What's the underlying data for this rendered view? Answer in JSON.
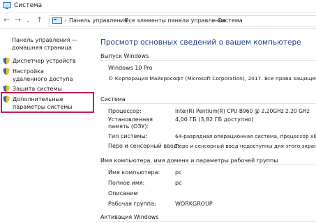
{
  "window": {
    "title": "Система"
  },
  "breadcrumb": [
    "Панель управления",
    "Все элементы панели управления",
    "Система"
  ],
  "sidebar": {
    "home": "Панель управления — домашняя страница",
    "items": [
      {
        "label": "Диспетчер устройств"
      },
      {
        "label": "Настройка удаленного доступа"
      },
      {
        "label": "Защита системы"
      },
      {
        "label": "Дополнительные параметры системы"
      }
    ]
  },
  "main": {
    "title": "Просмотр основных сведений о вашем компьютере",
    "edition": {
      "heading": "Выпуск Windows",
      "name": "Windows 10 Pro",
      "copyright": "© Корпорация Майкрософт (Microsoft Corporation), 2017. Все права защищены."
    },
    "system": {
      "heading": "Система",
      "rows": [
        {
          "key": "Процессор:",
          "value": "Intel(R) Pentium(R) CPU B960 @ 2.20GHz   2.20 GHz"
        },
        {
          "key": "Установленная память (ОЗУ):",
          "value": "4,00 ГБ (3,82 ГБ доступно)"
        },
        {
          "key": "Тип системы:",
          "value": "64-разрядная операционная система, процессор x64"
        },
        {
          "key": "Перо и сенсорный ввод:",
          "value": "Перо и сенсорный ввод недоступны для этого экрана"
        }
      ]
    },
    "computer": {
      "heading": "Имя компьютера, имя домена и параметры рабочей группы",
      "rows": [
        {
          "key": "Имя компьютера:",
          "value": "pc"
        },
        {
          "key": "Полное имя:",
          "value": "pc"
        },
        {
          "key": "Описание:",
          "value": ""
        },
        {
          "key": "Рабочая группа:",
          "value": "WORKGROUP"
        }
      ]
    },
    "activation": {
      "heading": "Активация Windows"
    }
  },
  "colors": {
    "title_blue": "#1e3f84",
    "highlight": "#c2185b"
  }
}
